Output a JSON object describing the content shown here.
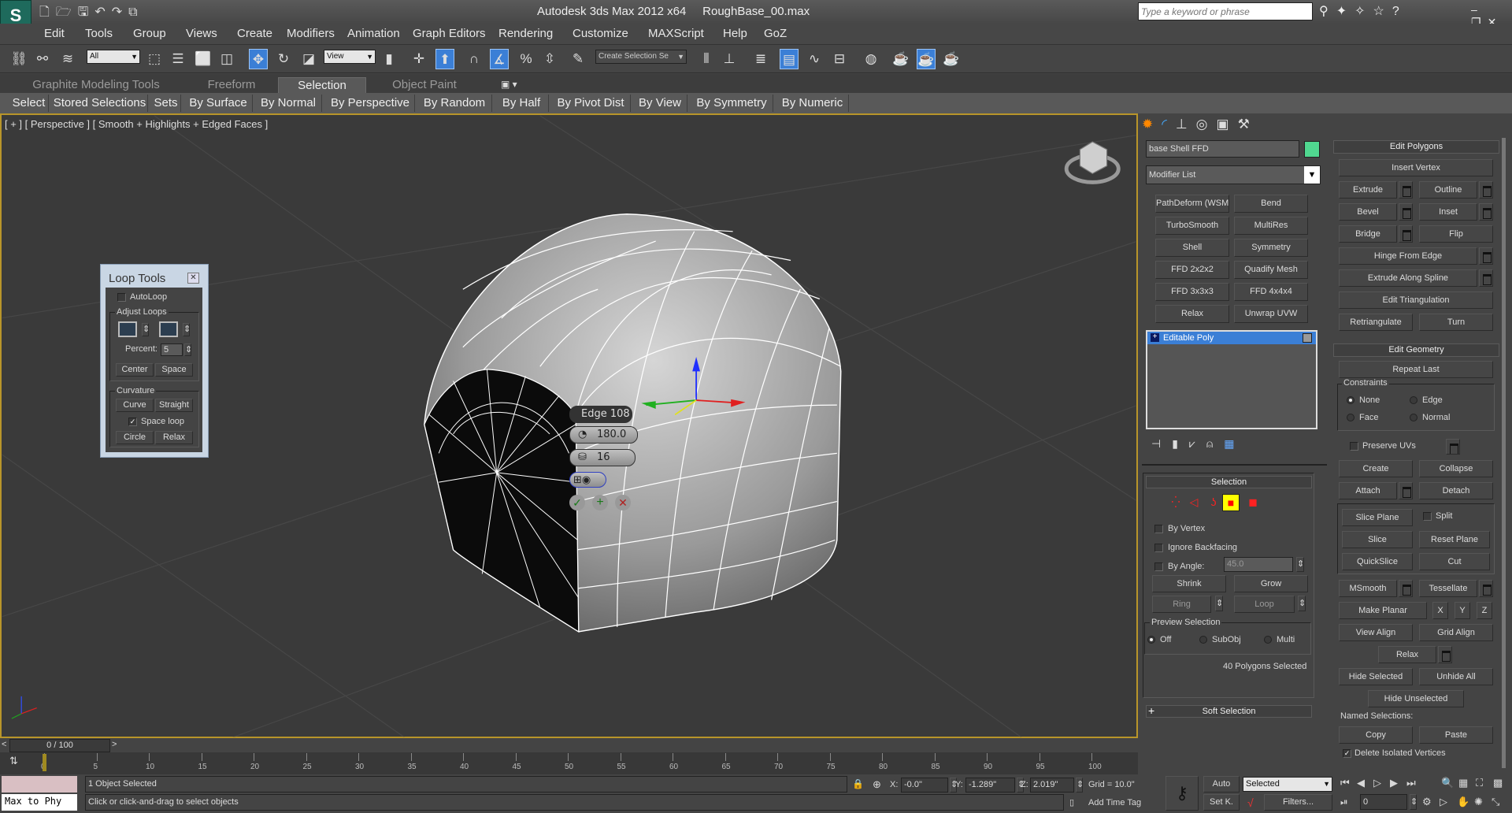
{
  "app": {
    "title": "Autodesk 3ds Max  2012 x64",
    "file": "RoughBase_00.max",
    "search_placeholder": "Type a keyword or phrase"
  },
  "menu": [
    "Edit",
    "Tools",
    "Group",
    "Views",
    "Create",
    "Modifiers",
    "Animation",
    "Graph Editors",
    "Rendering",
    "Customize",
    "MAXScript",
    "Help",
    "GoZ"
  ],
  "toolbar": {
    "filter": "All",
    "coord": "View",
    "named_sel": "Create Selection Se"
  },
  "ribbon": {
    "tabs": [
      "Graphite Modeling Tools",
      "Freeform",
      "Selection",
      "Object Paint"
    ],
    "active_tab": "Selection",
    "buttons": [
      "Select",
      "Stored Selections",
      "Sets",
      "By Surface",
      "By Normal",
      "By Perspective",
      "By Random",
      "By Half",
      "By Pivot Dist",
      "By View",
      "By Symmetry",
      "By Numeric"
    ]
  },
  "viewport": {
    "label": "[ + ] [ Perspective ] [ Smooth + Highlights + Edged Faces ]",
    "caddy": {
      "title": "Edge 108",
      "angle": "180.0",
      "segments": "16"
    }
  },
  "loop_tools": {
    "title": "Loop Tools",
    "autoloop": "AutoLoop",
    "autoloop_checked": false,
    "adjust_loops": "Adjust Loops",
    "percent_label": "Percent:",
    "percent": "5",
    "center": "Center",
    "space": "Space",
    "curvature": "Curvature",
    "curve": "Curve",
    "straight": "Straight",
    "space_loop": "Space loop",
    "space_loop_checked": true,
    "circle": "Circle",
    "relax": "Relax"
  },
  "command_panel": {
    "object_name": "base Shell FFD",
    "object_color": "#50d890",
    "modifier_list": "Modifier List",
    "modifiers": [
      "PathDeform (WSM)",
      "Bend",
      "TurboSmooth",
      "MultiRes",
      "Shell",
      "Symmetry",
      "FFD 2x2x2",
      "Quadify Mesh",
      "FFD 3x3x3",
      "FFD 4x4x4",
      "Relax",
      "Unwrap UVW"
    ],
    "stack": [
      "Editable Poly"
    ],
    "selection": {
      "title": "Selection",
      "by_vertex": "By Vertex",
      "ignore_backfacing": "Ignore Backfacing",
      "by_angle": "By Angle:",
      "angle": "45.0",
      "shrink": "Shrink",
      "grow": "Grow",
      "ring": "Ring",
      "loop": "Loop",
      "preview": "Preview Selection",
      "off": "Off",
      "subobj": "SubObj",
      "multi": "Multi",
      "preview_value": "Off",
      "status": "40 Polygons Selected",
      "active_level": "polygon"
    },
    "soft_selection": "Soft Selection",
    "edit_polygons": {
      "title": "Edit Polygons",
      "insert_vertex": "Insert Vertex",
      "extrude": "Extrude",
      "outline": "Outline",
      "bevel": "Bevel",
      "inset": "Inset",
      "bridge": "Bridge",
      "flip": "Flip",
      "hinge": "Hinge From Edge",
      "extrude_spline": "Extrude Along Spline",
      "edit_tri": "Edit Triangulation",
      "retri": "Retriangulate",
      "turn": "Turn"
    },
    "edit_geometry": {
      "title": "Edit Geometry",
      "repeat_last": "Repeat Last",
      "constraints": "Constraints",
      "none": "None",
      "edge": "Edge",
      "face": "Face",
      "normal": "Normal",
      "constraint_value": "None",
      "preserve_uvs": "Preserve UVs",
      "create": "Create",
      "collapse": "Collapse",
      "attach": "Attach",
      "detach": "Detach",
      "slice_plane": "Slice Plane",
      "split": "Split",
      "slice": "Slice",
      "reset_plane": "Reset Plane",
      "quickslice": "QuickSlice",
      "cut": "Cut",
      "msmooth": "MSmooth",
      "tessellate": "Tessellate",
      "make_planar": "Make Planar",
      "x": "X",
      "y": "Y",
      "z": "Z",
      "view_align": "View Align",
      "grid_align": "Grid Align",
      "relax": "Relax",
      "hide_selected": "Hide Selected",
      "unhide_all": "Unhide All",
      "hide_unselected": "Hide Unselected",
      "named_selections": "Named Selections:",
      "copy": "Copy",
      "paste": "Paste",
      "delete_isolated": "Delete Isolated Vertices",
      "delete_isolated_checked": true
    }
  },
  "timeline": {
    "frame": "0 / 100",
    "ticks": [
      "0",
      "5",
      "10",
      "15",
      "20",
      "25",
      "30",
      "35",
      "40",
      "45",
      "50",
      "55",
      "60",
      "65",
      "70",
      "75",
      "80",
      "85",
      "90",
      "95",
      "100"
    ]
  },
  "status": {
    "maxscript": "Max to Phy",
    "selected": "1 Object Selected",
    "prompt": "Click or click-and-drag to select objects",
    "x_label": "X:",
    "x": "-0.0\"",
    "y_label": "Y:",
    "y": "-1.289\"",
    "z_label": "Z:",
    "z": "2.019\"",
    "grid": "Grid = 10.0\"",
    "add_time_tag": "Add Time Tag",
    "auto": "Auto",
    "set_key": "Set K.",
    "key_filter": "Selected",
    "filters": "Filters...",
    "current_frame": "0"
  },
  "colors": {
    "accent": "#3b7fd6",
    "viewport_border": "#b8952a",
    "active_level": "#ffff00"
  }
}
